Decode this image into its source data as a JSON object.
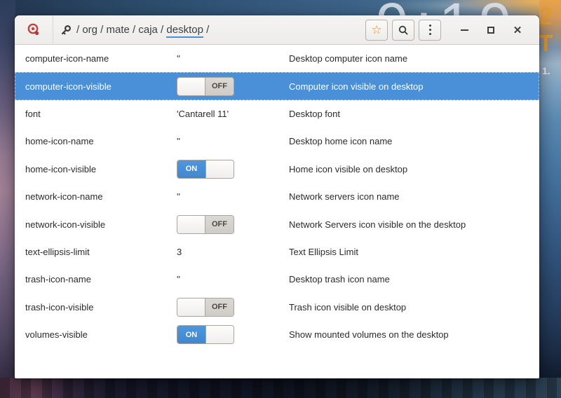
{
  "header": {
    "breadcrumb": {
      "prefix": "/ org / mate / caja / ",
      "current": "desktop",
      "suffix": " /"
    },
    "buttons": {
      "bookmark_glyph": "☆"
    }
  },
  "list": {
    "toggle_labels": {
      "on": "ON",
      "off": "OFF"
    },
    "rows": [
      {
        "key": "computer-icon-name",
        "type": "text",
        "value": "''",
        "description": "Desktop computer icon name",
        "selected": false
      },
      {
        "key": "computer-icon-visible",
        "type": "toggle",
        "state": "OFF",
        "description": "Computer icon visible on desktop",
        "selected": true
      },
      {
        "key": "font",
        "type": "text",
        "value": "'Cantarell 11'",
        "description": "Desktop font",
        "selected": false
      },
      {
        "key": "home-icon-name",
        "type": "text",
        "value": "''",
        "description": "Desktop home icon name",
        "selected": false
      },
      {
        "key": "home-icon-visible",
        "type": "toggle",
        "state": "ON",
        "description": "Home icon visible on desktop",
        "selected": false
      },
      {
        "key": "network-icon-name",
        "type": "text",
        "value": "''",
        "description": "Network servers icon name",
        "selected": false
      },
      {
        "key": "network-icon-visible",
        "type": "toggle",
        "state": "OFF",
        "description": "Network Servers icon visible on the desktop",
        "selected": false
      },
      {
        "key": "text-ellipsis-limit",
        "type": "text",
        "value": "3",
        "description": "Text Ellipsis Limit",
        "selected": false
      },
      {
        "key": "trash-icon-name",
        "type": "text",
        "value": "''",
        "description": "Desktop trash icon name",
        "selected": false
      },
      {
        "key": "trash-icon-visible",
        "type": "toggle",
        "state": "OFF",
        "description": "Trash icon visible on desktop",
        "selected": false
      },
      {
        "key": "volumes-visible",
        "type": "toggle",
        "state": "ON",
        "description": "Show mounted volumes on the desktop",
        "selected": false
      }
    ]
  },
  "desktop_background": {
    "clock_time": "9:19",
    "date_fragments": [
      "2",
      "T",
      "1."
    ]
  },
  "colors": {
    "selection_blue": "#4a90d8",
    "switch_on_blue": "#4a90d9",
    "titlebar_bg": "#f2f1ef",
    "accent_orange": "#e29a33"
  }
}
